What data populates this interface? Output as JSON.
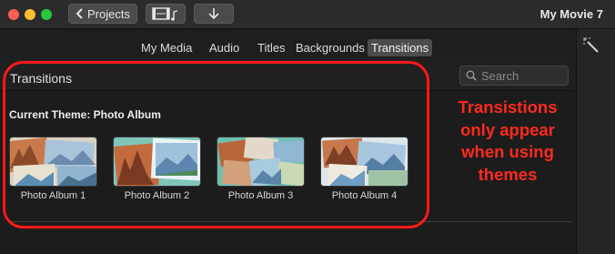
{
  "window": {
    "title": "My Movie 7"
  },
  "toolbar": {
    "projects_label": "Projects",
    "icons": [
      "chevron-left-icon",
      "film-music-icon",
      "import-arrow-icon"
    ]
  },
  "tabs": [
    {
      "label": "My Media",
      "selected": false
    },
    {
      "label": "Audio",
      "selected": false
    },
    {
      "label": "Titles",
      "selected": false
    },
    {
      "label": "Backgrounds",
      "selected": false
    },
    {
      "label": "Transitions",
      "selected": true
    }
  ],
  "browser": {
    "title": "Transitions",
    "search": {
      "placeholder": "Search",
      "value": ""
    },
    "section_title": "Current Theme: Photo Album",
    "items": [
      {
        "label": "Photo Album 1"
      },
      {
        "label": "Photo Album 2"
      },
      {
        "label": "Photo Album 3"
      },
      {
        "label": "Photo Album 4"
      }
    ]
  },
  "annotation": {
    "lines": [
      "Transistions",
      "only appear",
      "when using",
      "themes"
    ],
    "color": "#ff2a1f"
  }
}
